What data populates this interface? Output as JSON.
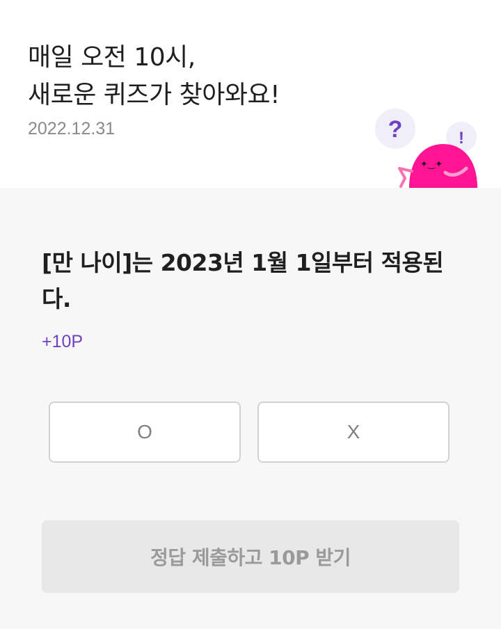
{
  "header": {
    "headline_line1": "매일 오전 10시,",
    "headline_line2": "새로운 퀴즈가 찾아와요!",
    "date": "2022.12.31"
  },
  "mascot": {
    "question_mark": "?",
    "exclaim_mark": "!",
    "body_color": "#ff1493",
    "bubble_color": "#f0eef8",
    "mark_color": "#6f42c1"
  },
  "quiz": {
    "question": "[만 나이]는 2023년 1월 1일부터 적용된다.",
    "points": "+10P",
    "option_o": "O",
    "option_x": "X",
    "submit_label": "정답 제출하고 10P 받기"
  },
  "colors": {
    "accent": "#6f42c1",
    "background": "#f7f7f7",
    "disabled_button": "#e8e8e8"
  }
}
